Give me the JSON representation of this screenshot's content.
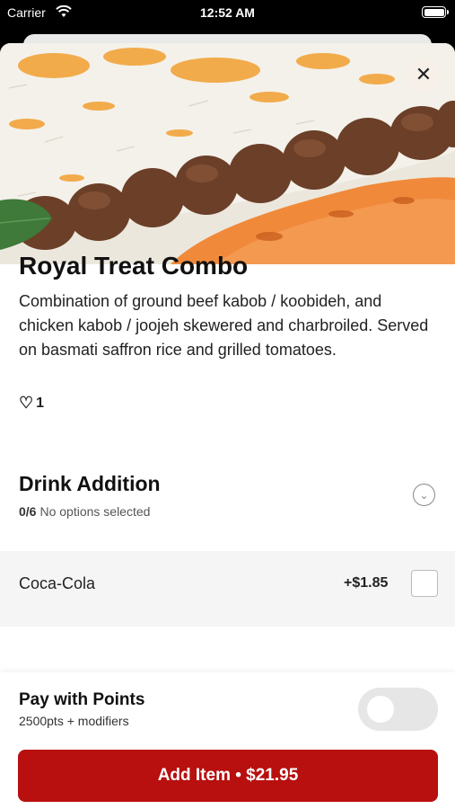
{
  "status_bar": {
    "carrier": "Carrier",
    "time": "12:52 AM"
  },
  "item": {
    "title": "Royal Treat Combo",
    "description": "Combination of ground beef kabob / koobideh, and chicken kabob / joojeh skewered and charbroiled. Served on basmati saffron rice and grilled tomatoes.",
    "likes": "1"
  },
  "drink_addition": {
    "title": "Drink Addition",
    "count": "0/6",
    "status": "No options selected",
    "options": [
      {
        "name": "Coca-Cola",
        "price": "+$1.85",
        "selected": false
      }
    ]
  },
  "points": {
    "title": "Pay with Points",
    "subtitle": "2500pts + modifiers",
    "enabled": false
  },
  "add_button": {
    "label": "Add Item • $21.95"
  },
  "colors": {
    "accent": "#b80f0f"
  },
  "icons": [
    "wifi-icon",
    "battery-icon",
    "close-icon",
    "heart-icon",
    "chevron-down-icon",
    "checkbox"
  ]
}
